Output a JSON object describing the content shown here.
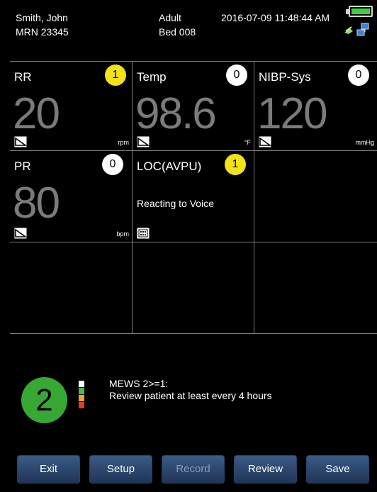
{
  "header": {
    "patient_name": "Smith, John",
    "mrn": "MRN  23345",
    "patient_type": "Adult",
    "bed": "Bed 008",
    "datetime": "2016-07-09 11:48:44 AM",
    "battery_icon": "battery-icon",
    "network_icon": "network-icon"
  },
  "tiles": [
    {
      "label": "RR",
      "score": "1",
      "score_color": "#f2e21a",
      "value": "20",
      "unit": "rpm",
      "icon": "trend-icon"
    },
    {
      "label": "Temp",
      "score": "0",
      "score_color": "#ffffff",
      "value": "98.6",
      "unit": "°F",
      "icon": "trend-icon"
    },
    {
      "label": "NIBP-Sys",
      "score": "0",
      "score_color": "#ffffff",
      "value": "120",
      "unit": "mmHg",
      "icon": "trend-icon"
    },
    {
      "label": "PR",
      "score": "0",
      "score_color": "#ffffff",
      "value": "80",
      "unit": "bpm",
      "icon": "trend-icon"
    },
    {
      "label": "LOC(AVPU)",
      "score": "1",
      "score_color": "#f2e21a",
      "status": "Reacting to Voice",
      "icon": "keypad-icon"
    }
  ],
  "score": {
    "total": "2",
    "color": "#38a835",
    "line1": "MEWS 2>=1:",
    "line2": "Review patient at least every 4 hours"
  },
  "buttons": {
    "exit": "Exit",
    "setup": "Setup",
    "record": "Record",
    "review": "Review",
    "save": "Save"
  }
}
